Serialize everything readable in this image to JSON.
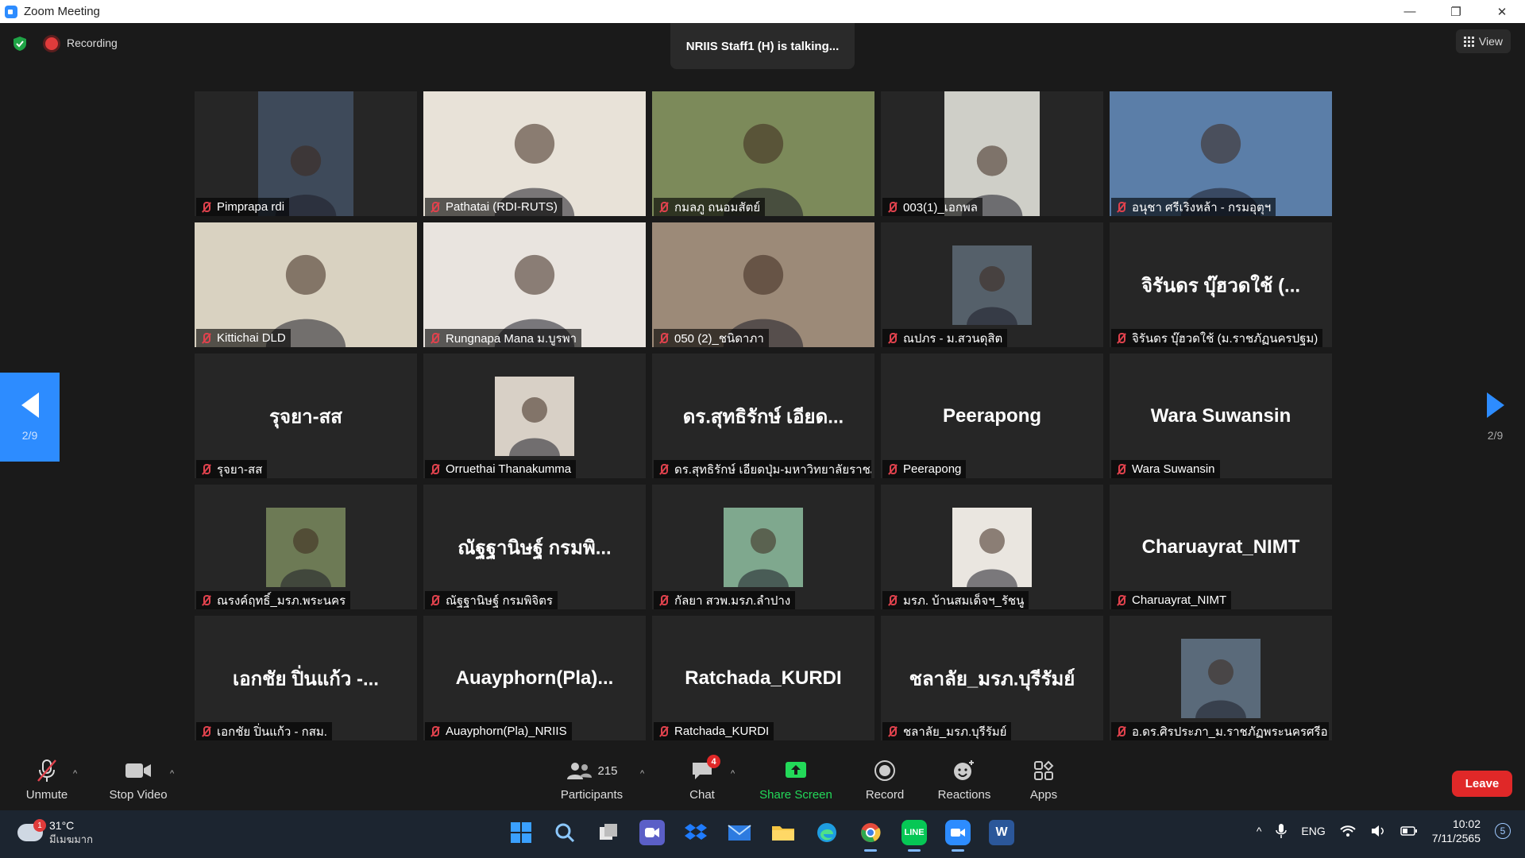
{
  "window": {
    "title": "Zoom Meeting"
  },
  "topbar": {
    "recording_label": "Recording",
    "talking": "NRIIS Staff1 (H) is talking...",
    "view_label": "View"
  },
  "pager": {
    "left": "2/9",
    "right": "2/9"
  },
  "tiles": [
    {
      "bigname": "",
      "name": "Pimprapa rdi",
      "photo": "#3e4a5a"
    },
    {
      "bigname": "",
      "name": "Pathatai (RDI-RUTS)",
      "photo": "#e8e2d8"
    },
    {
      "bigname": "",
      "name": "กมลภู ถนอมสัตย์",
      "photo": "#7c8a5a"
    },
    {
      "bigname": "",
      "name": "003(1)_เอกพล",
      "photo": "#cfcfc8"
    },
    {
      "bigname": "",
      "name": "อนุชา ศรีเริงหล้า - กรมอุตุฯ",
      "photo": "#5b7ea8"
    },
    {
      "bigname": "",
      "name": "Kittichai DLD",
      "photo": "#d9d2c1"
    },
    {
      "bigname": "",
      "name": "Rungnapa Mana ม.บูรพา",
      "photo": "#e9e4df"
    },
    {
      "bigname": "",
      "name": "050 (2)_ชนิดาภา",
      "photo": "#9c8a78"
    },
    {
      "bigname": "",
      "name": "ณปภร - ม.สวนดุสิต",
      "photo": "#55606a"
    },
    {
      "bigname": "จิรันดร บุ๊ฮวดใช้ (...",
      "name": "จิรันดร บุ๊ฮวดใช้ (ม.ราชภัฏนครปฐม)",
      "photo": ""
    },
    {
      "bigname": "รุจยา-สส",
      "name": "รุจยา-สส",
      "photo": ""
    },
    {
      "bigname": "",
      "name": "Orruethai Thanakumma",
      "photo": "#d8d0c6"
    },
    {
      "bigname": "ดร.สุทธิรักษ์ เอียด...",
      "name": "ดร.สุทธิรักษ์ เอียดปุ่ม-มหาวิทยาลัยราชภั...",
      "photo": ""
    },
    {
      "bigname": "Peerapong",
      "name": "Peerapong",
      "photo": ""
    },
    {
      "bigname": "Wara Suwansin",
      "name": "Wara Suwansin",
      "photo": ""
    },
    {
      "bigname": "",
      "name": "ณรงค์ฤทธิ์_มรภ.พระนคร",
      "photo": "#6d7a55"
    },
    {
      "bigname": "ณัฐฐานิษฐ์ กรมพิ...",
      "name": "ณัฐฐานิษฐ์ กรมพิจิตร",
      "photo": ""
    },
    {
      "bigname": "",
      "name": "กัลยา สวพ.มรภ.ลำปาง",
      "photo": "#7fa88e"
    },
    {
      "bigname": "",
      "name": "มรภ. บ้านสมเด็จฯ_รัชนู",
      "photo": "#eae6e0"
    },
    {
      "bigname": "Charuayrat_NIMT",
      "name": "Charuayrat_NIMT",
      "photo": ""
    },
    {
      "bigname": "เอกชัย ปิ่นแก้ว -...",
      "name": "เอกชัย ปิ่นแก้ว - กสม.",
      "photo": ""
    },
    {
      "bigname": "Auayphorn(Pla)...",
      "name": "Auayphorn(Pla)_NRIIS",
      "photo": ""
    },
    {
      "bigname": "Ratchada_KURDI",
      "name": "Ratchada_KURDI",
      "photo": ""
    },
    {
      "bigname": "ชลาลัย_มรภ.บุรีรัมย์",
      "name": "ชลาลัย_มรภ.บุรีรัมย์",
      "photo": ""
    },
    {
      "bigname": "",
      "name": "อ.ดร.ศิรประภา_ม.ราชภัฏพระนครศรีอยุธ...",
      "photo": "#5a6a7a"
    }
  ],
  "toolbar": {
    "unmute": "Unmute",
    "stop_video": "Stop Video",
    "participants_count": "215",
    "participants": "Participants",
    "chat": "Chat",
    "chat_badge": "4",
    "share_screen": "Share Screen",
    "record": "Record",
    "reactions": "Reactions",
    "apps": "Apps",
    "leave": "Leave"
  },
  "taskbar": {
    "weather_badge": "1",
    "temperature": "31°C",
    "weather_desc": "มีเมฆมาก",
    "language": "ENG",
    "time": "10:02",
    "date": "7/11/2565",
    "notifications": "5"
  }
}
